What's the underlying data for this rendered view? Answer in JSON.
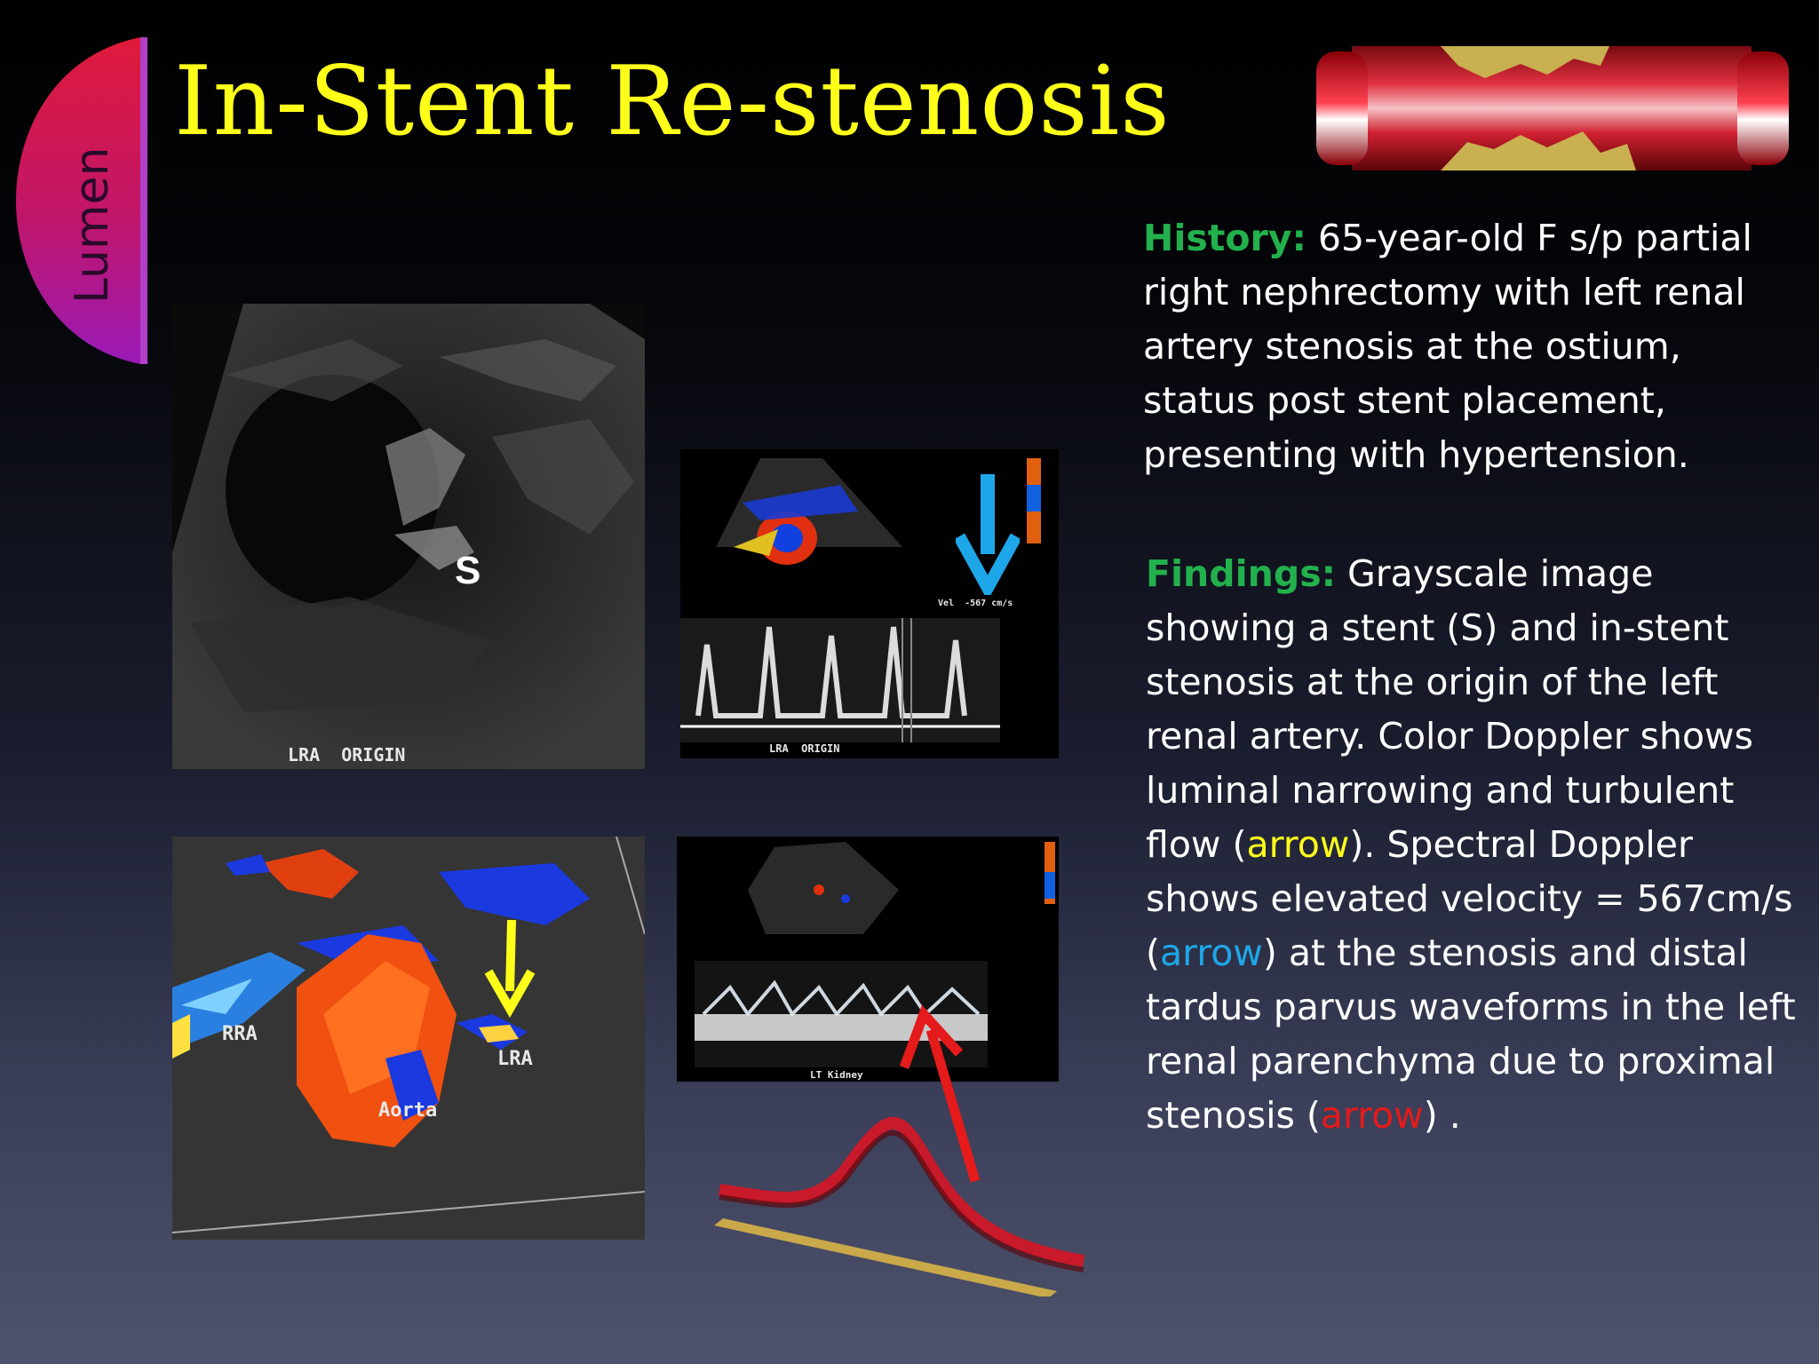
{
  "slide": {
    "title": "In-Stent Re-stenosis",
    "section_tab": "Lumen"
  },
  "images": {
    "grayscale_label": "LRA  ORIGIN",
    "stent_marker": "S",
    "color_doppler_labels": {
      "rra": "RRA",
      "lra": "LRA",
      "aorta": "Aorta"
    },
    "spectral_top_label": "LRA  ORIGIN",
    "spectral_top_velocity": "Vel  -567 cm/s",
    "spectral_bottom_label": "LT Kidney"
  },
  "history": {
    "heading": "History:",
    "text": " 65-year-old F s/p partial right nephrectomy with left renal artery stenosis at the ostium, status post stent placement, presenting with hypertension."
  },
  "findings": {
    "heading": "Findings:",
    "part1": " Grayscale image showing a stent (S) and in-stent stenosis at the origin of the left renal artery.  Color Doppler shows luminal narrowing and turbulent flow (",
    "arrow_yellow": "arrow",
    "part2": ").  Spectral Doppler shows elevated velocity = 567cm/s (",
    "arrow_blue": "arrow",
    "part3": ") at the stenosis and distal tardus parvus waveforms in the left renal parenchyma due to proximal stenosis (",
    "arrow_red": "arrow",
    "part4": ") ."
  },
  "colors": {
    "title": "#ffff1a",
    "heading": "#22b14c",
    "arrow_yellow": "#ffff1a",
    "arrow_blue": "#1ea7e8",
    "arrow_red": "#e51a1a"
  }
}
